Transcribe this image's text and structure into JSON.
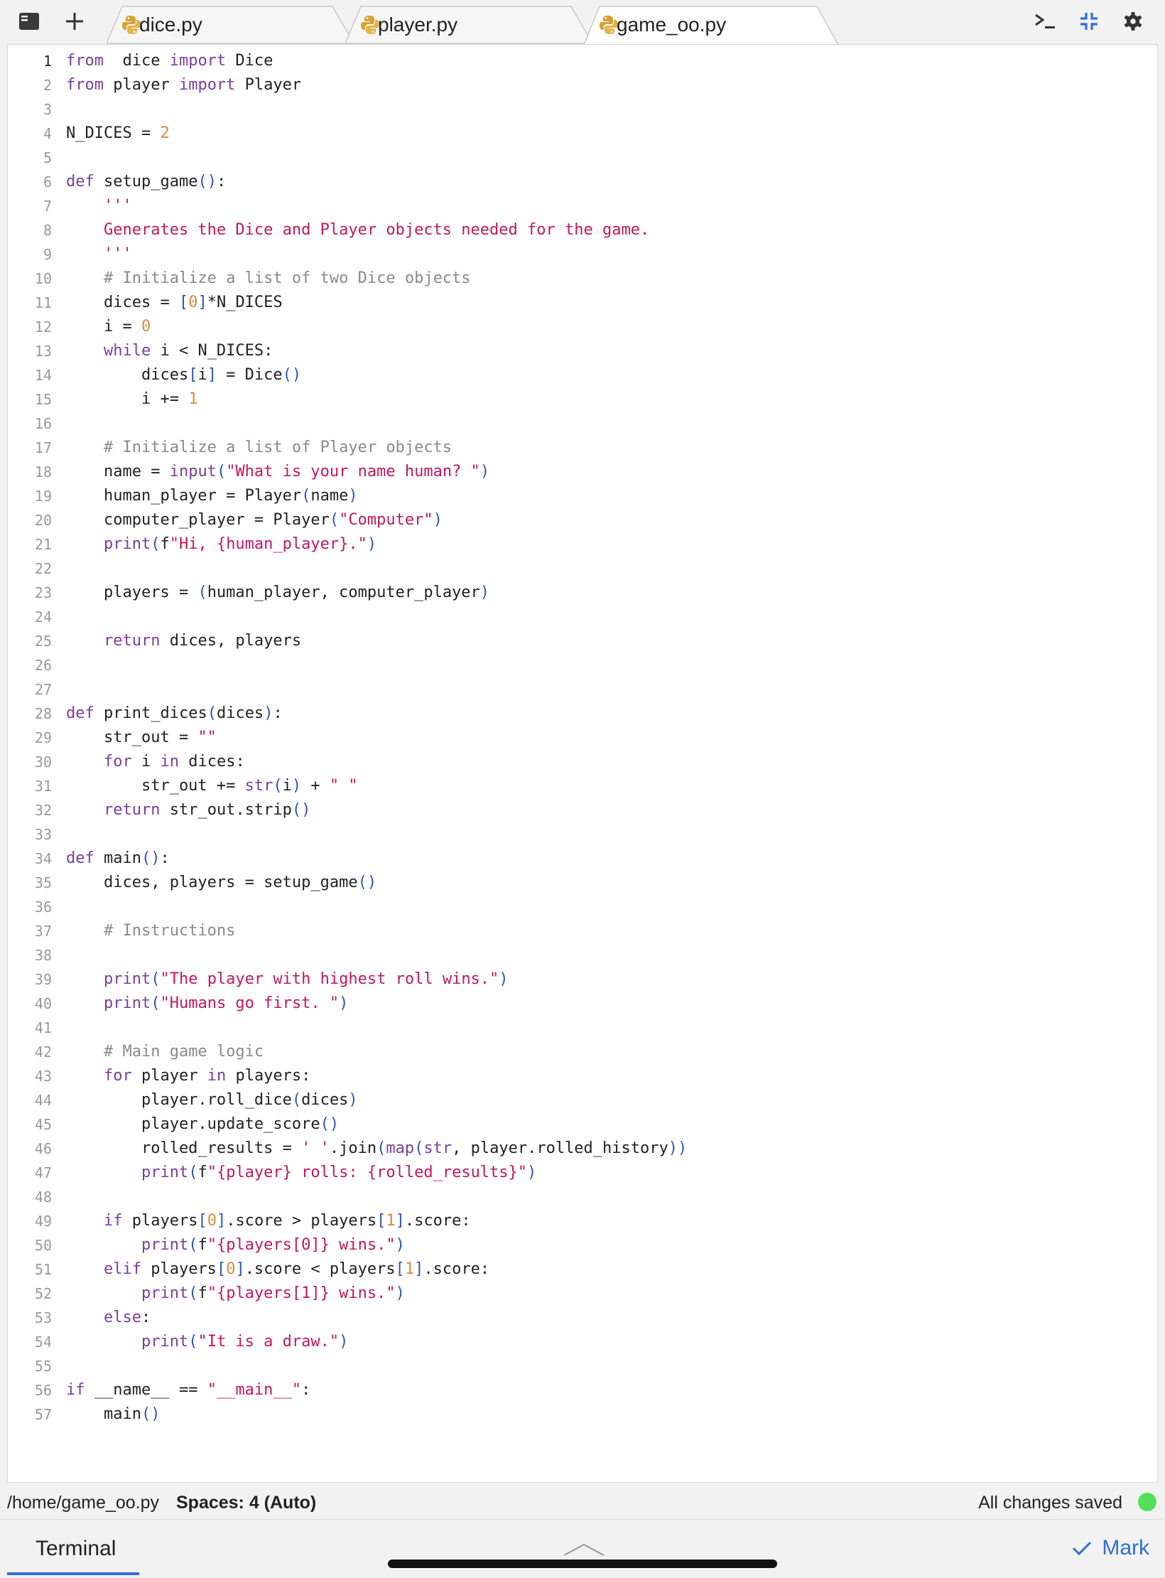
{
  "tabs": [
    {
      "label": "dice.py",
      "active": false
    },
    {
      "label": "player.py",
      "active": false
    },
    {
      "label": "game_oo.py",
      "active": true
    }
  ],
  "icons": {
    "sidebar": "sidebar-icon",
    "new_tab": "plus-icon",
    "file": "python-icon",
    "terminal": "terminal-icon",
    "collapse": "collapse-icon",
    "settings": "gear-icon",
    "mark": "checkmark-icon",
    "panel_toggle": "chevron-up-icon"
  },
  "colors": {
    "keyword": "#7a3e9d",
    "string": "#c2185b",
    "comment": "#8a8a8a",
    "number": "#d98c3f",
    "bracket": "#2f56b7",
    "accent": "#2f6fd6",
    "saved_indicator": "#52e05a"
  },
  "editor": {
    "active_line": 1,
    "lines": [
      [
        [
          "kw",
          "from"
        ],
        [
          "",
          "  dice "
        ],
        [
          "kw",
          "import"
        ],
        [
          "",
          " Dice"
        ]
      ],
      [
        [
          "kw",
          "from"
        ],
        [
          "",
          " player "
        ],
        [
          "kw",
          "import"
        ],
        [
          "",
          " Player"
        ]
      ],
      [],
      [
        [
          "",
          "N_DICES = "
        ],
        [
          "num",
          "2"
        ]
      ],
      [],
      [
        [
          "kw",
          "def"
        ],
        [
          "",
          " setup_game"
        ],
        [
          "br",
          "()"
        ],
        [
          "",
          ":"
        ]
      ],
      [
        [
          "",
          "    "
        ],
        [
          "str",
          "'''"
        ]
      ],
      [
        [
          "",
          "    "
        ],
        [
          "str",
          "Generates the Dice and Player objects needed for the game."
        ]
      ],
      [
        [
          "",
          "    "
        ],
        [
          "str",
          "'''"
        ]
      ],
      [
        [
          "",
          "    "
        ],
        [
          "cm",
          "# Initialize a list of two Dice objects"
        ]
      ],
      [
        [
          "",
          "    dices = "
        ],
        [
          "br",
          "["
        ],
        [
          "num",
          "0"
        ],
        [
          "br",
          "]"
        ],
        [
          "",
          "*N_DICES"
        ]
      ],
      [
        [
          "",
          "    i = "
        ],
        [
          "num",
          "0"
        ]
      ],
      [
        [
          "",
          "    "
        ],
        [
          "kw",
          "while"
        ],
        [
          "",
          " i < N_DICES:"
        ]
      ],
      [
        [
          "",
          "        dices"
        ],
        [
          "br",
          "["
        ],
        [
          "",
          "i"
        ],
        [
          "br",
          "]"
        ],
        [
          "",
          " = Dice"
        ],
        [
          "br",
          "()"
        ]
      ],
      [
        [
          "",
          "        i += "
        ],
        [
          "num",
          "1"
        ]
      ],
      [],
      [
        [
          "",
          "    "
        ],
        [
          "cm",
          "# Initialize a list of Player objects"
        ]
      ],
      [
        [
          "",
          "    name = "
        ],
        [
          "bi",
          "input"
        ],
        [
          "br",
          "("
        ],
        [
          "str",
          "\"What is your name human? \""
        ],
        [
          "br",
          ")"
        ]
      ],
      [
        [
          "",
          "    human_player = Player"
        ],
        [
          "br",
          "("
        ],
        [
          "",
          "name"
        ],
        [
          "br",
          ")"
        ]
      ],
      [
        [
          "",
          "    computer_player = Player"
        ],
        [
          "br",
          "("
        ],
        [
          "str",
          "\"Computer\""
        ],
        [
          "br",
          ")"
        ]
      ],
      [
        [
          "",
          "    "
        ],
        [
          "bi",
          "print"
        ],
        [
          "br",
          "("
        ],
        [
          "",
          "f"
        ],
        [
          "str",
          "\"Hi, {human_player}.\""
        ],
        [
          "br",
          ")"
        ]
      ],
      [],
      [
        [
          "",
          "    players = "
        ],
        [
          "br",
          "("
        ],
        [
          "",
          "human_player, computer_player"
        ],
        [
          "br",
          ")"
        ]
      ],
      [],
      [
        [
          "",
          "    "
        ],
        [
          "kw",
          "return"
        ],
        [
          "",
          " dices, players"
        ]
      ],
      [],
      [],
      [
        [
          "kw",
          "def"
        ],
        [
          "",
          " print_dices"
        ],
        [
          "br",
          "("
        ],
        [
          "",
          "dices"
        ],
        [
          "br",
          ")"
        ],
        [
          "",
          ":"
        ]
      ],
      [
        [
          "",
          "    str_out = "
        ],
        [
          "str",
          "\"\""
        ]
      ],
      [
        [
          "",
          "    "
        ],
        [
          "kw",
          "for"
        ],
        [
          "",
          " i "
        ],
        [
          "kw",
          "in"
        ],
        [
          "",
          " dices:"
        ]
      ],
      [
        [
          "",
          "        str_out += "
        ],
        [
          "bi",
          "str"
        ],
        [
          "br",
          "("
        ],
        [
          "",
          "i"
        ],
        [
          "br",
          ")"
        ],
        [
          "",
          " + "
        ],
        [
          "str",
          "\" \""
        ]
      ],
      [
        [
          "",
          "    "
        ],
        [
          "kw",
          "return"
        ],
        [
          "",
          " str_out.strip"
        ],
        [
          "br",
          "()"
        ]
      ],
      [],
      [
        [
          "kw",
          "def"
        ],
        [
          "",
          " main"
        ],
        [
          "br",
          "()"
        ],
        [
          "",
          ":"
        ]
      ],
      [
        [
          "",
          "    dices, players = setup_game"
        ],
        [
          "br",
          "()"
        ]
      ],
      [],
      [
        [
          "",
          "    "
        ],
        [
          "cm",
          "# Instructions"
        ]
      ],
      [],
      [
        [
          "",
          "    "
        ],
        [
          "bi",
          "print"
        ],
        [
          "br",
          "("
        ],
        [
          "str",
          "\"The player with highest roll wins.\""
        ],
        [
          "br",
          ")"
        ]
      ],
      [
        [
          "",
          "    "
        ],
        [
          "bi",
          "print"
        ],
        [
          "br",
          "("
        ],
        [
          "str",
          "\"Humans go first. \""
        ],
        [
          "br",
          ")"
        ]
      ],
      [],
      [
        [
          "",
          "    "
        ],
        [
          "cm",
          "# Main game logic"
        ]
      ],
      [
        [
          "",
          "    "
        ],
        [
          "kw",
          "for"
        ],
        [
          "",
          " player "
        ],
        [
          "kw",
          "in"
        ],
        [
          "",
          " players:"
        ]
      ],
      [
        [
          "",
          "        player.roll_dice"
        ],
        [
          "br",
          "("
        ],
        [
          "",
          "dices"
        ],
        [
          "br",
          ")"
        ]
      ],
      [
        [
          "",
          "        player.update_score"
        ],
        [
          "br",
          "()"
        ]
      ],
      [
        [
          "",
          "        rolled_results = "
        ],
        [
          "str",
          "' '"
        ],
        [
          "",
          ".join"
        ],
        [
          "br",
          "("
        ],
        [
          "bi",
          "map"
        ],
        [
          "br",
          "("
        ],
        [
          "bi",
          "str"
        ],
        [
          "",
          ", player.rolled_history"
        ],
        [
          "br",
          "))"
        ]
      ],
      [
        [
          "",
          "        "
        ],
        [
          "bi",
          "print"
        ],
        [
          "br",
          "("
        ],
        [
          "",
          "f"
        ],
        [
          "str",
          "\"{player} rolls: {rolled_results}\""
        ],
        [
          "br",
          ")"
        ]
      ],
      [],
      [
        [
          "",
          "    "
        ],
        [
          "kw",
          "if"
        ],
        [
          "",
          " players"
        ],
        [
          "br",
          "["
        ],
        [
          "num",
          "0"
        ],
        [
          "br",
          "]"
        ],
        [
          "",
          ".score > players"
        ],
        [
          "br",
          "["
        ],
        [
          "num",
          "1"
        ],
        [
          "br",
          "]"
        ],
        [
          "",
          ".score:"
        ]
      ],
      [
        [
          "",
          "        "
        ],
        [
          "bi",
          "print"
        ],
        [
          "br",
          "("
        ],
        [
          "",
          "f"
        ],
        [
          "str",
          "\"{players[0]} wins.\""
        ],
        [
          "br",
          ")"
        ]
      ],
      [
        [
          "",
          "    "
        ],
        [
          "kw",
          "elif"
        ],
        [
          "",
          " players"
        ],
        [
          "br",
          "["
        ],
        [
          "num",
          "0"
        ],
        [
          "br",
          "]"
        ],
        [
          "",
          ".score < players"
        ],
        [
          "br",
          "["
        ],
        [
          "num",
          "1"
        ],
        [
          "br",
          "]"
        ],
        [
          "",
          ".score:"
        ]
      ],
      [
        [
          "",
          "        "
        ],
        [
          "bi",
          "print"
        ],
        [
          "br",
          "("
        ],
        [
          "",
          "f"
        ],
        [
          "str",
          "\"{players[1]} wins.\""
        ],
        [
          "br",
          ")"
        ]
      ],
      [
        [
          "",
          "    "
        ],
        [
          "kw",
          "else"
        ],
        [
          "",
          ":"
        ]
      ],
      [
        [
          "",
          "        "
        ],
        [
          "bi",
          "print"
        ],
        [
          "br",
          "("
        ],
        [
          "str",
          "\"It is a draw.\""
        ],
        [
          "br",
          ")"
        ]
      ],
      [],
      [
        [
          "kw",
          "if"
        ],
        [
          "",
          " __name__ == "
        ],
        [
          "str",
          "\"__main__\""
        ],
        [
          "",
          ":"
        ]
      ],
      [
        [
          "",
          "    main"
        ],
        [
          "br",
          "()"
        ]
      ]
    ]
  },
  "status": {
    "path": "/home/game_oo.py",
    "spaces": "Spaces: 4 (Auto)",
    "saved": "All changes saved"
  },
  "bottom": {
    "terminal_label": "Terminal",
    "mark_label": "Mark"
  }
}
